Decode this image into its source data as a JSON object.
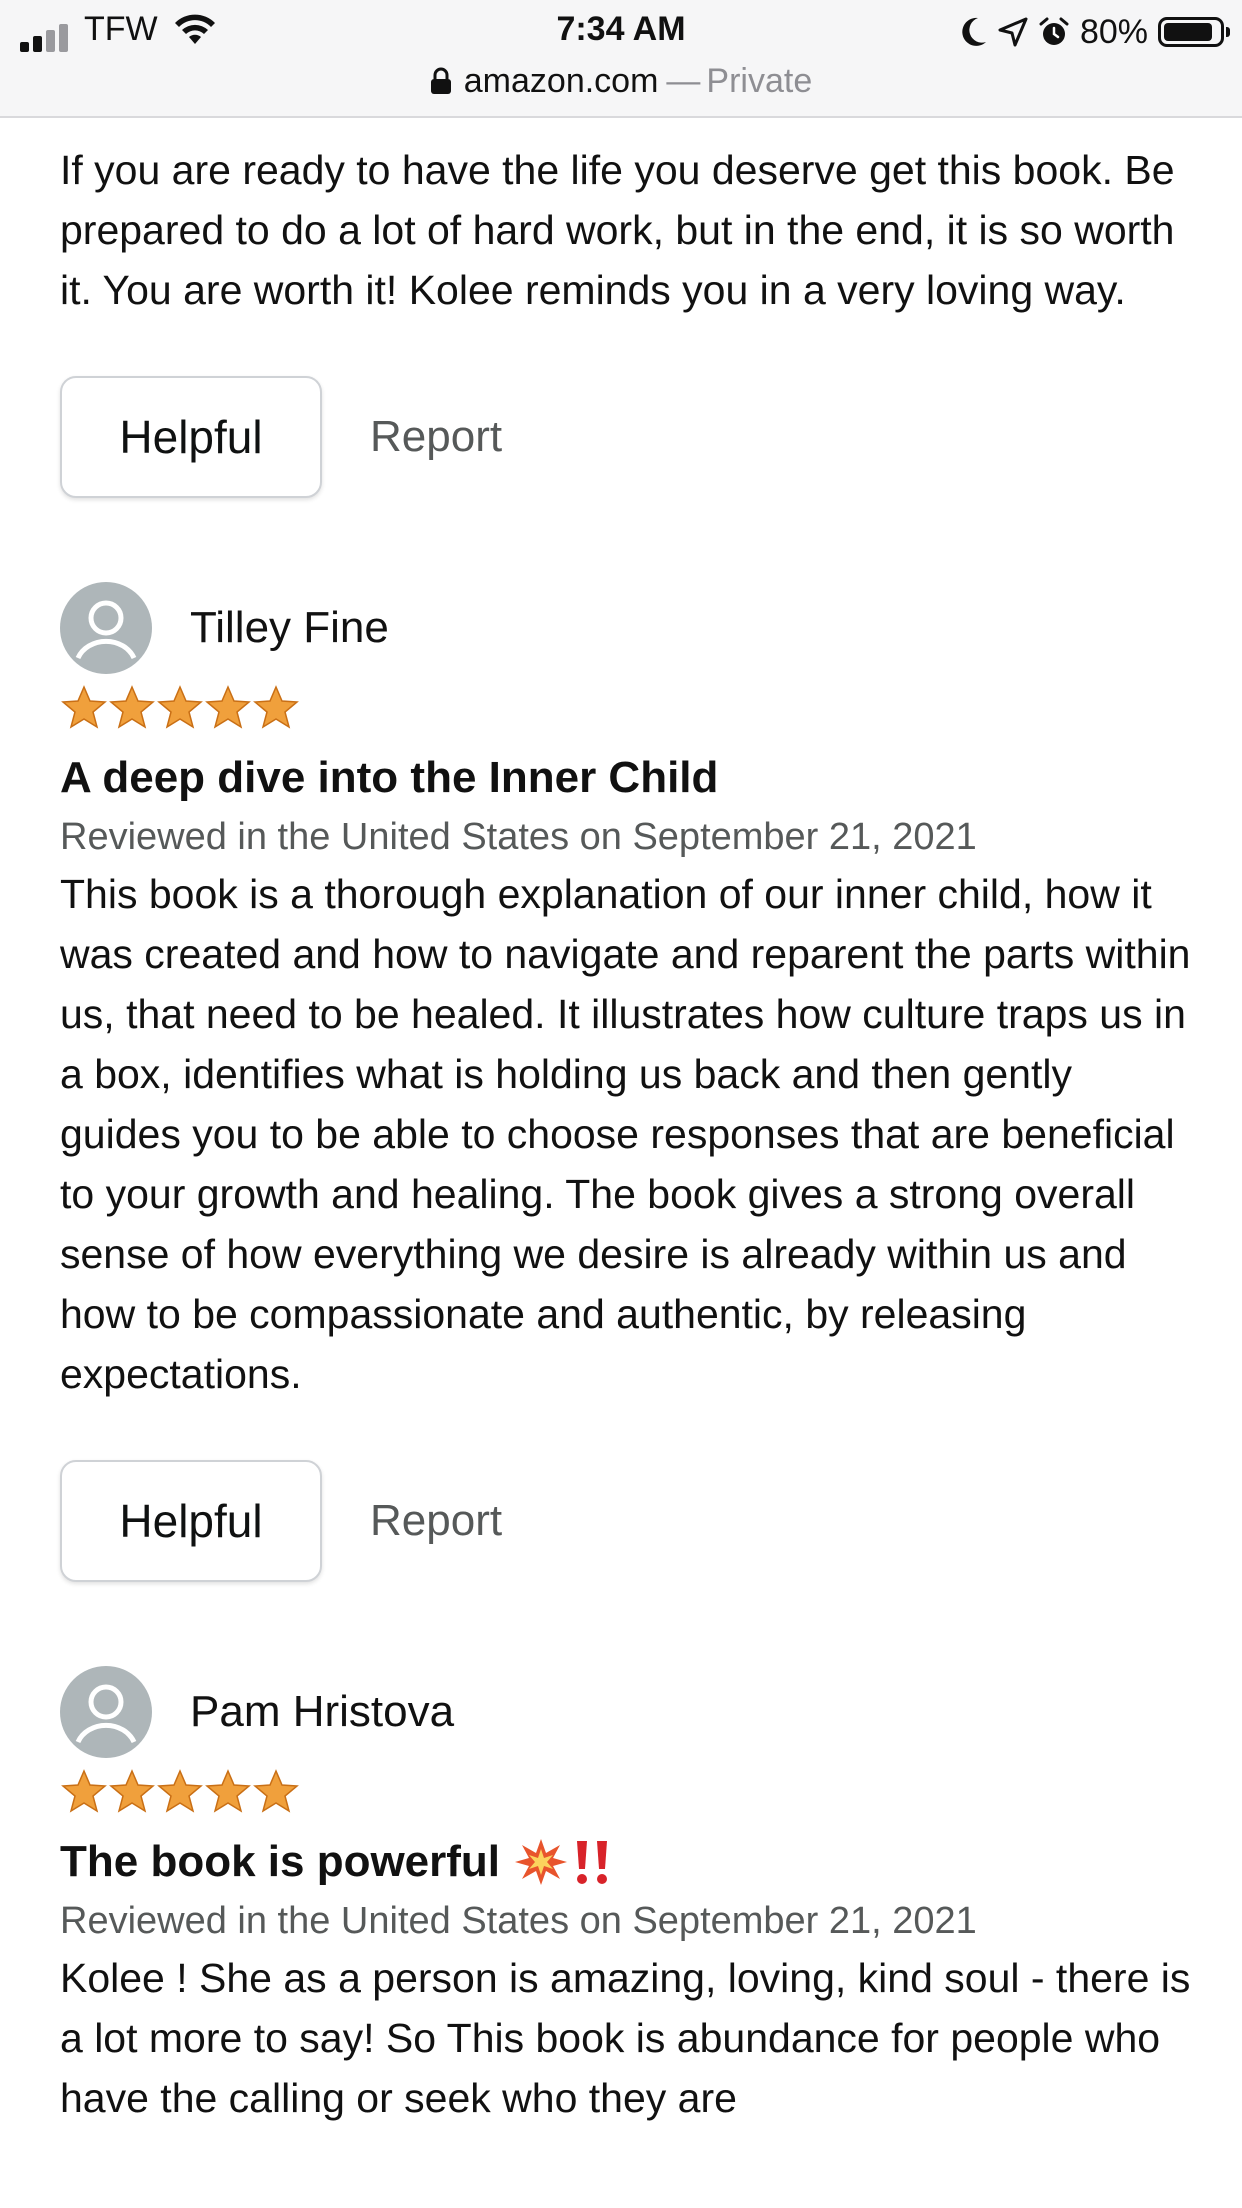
{
  "status_bar": {
    "carrier": "TFW",
    "time": "7:34 AM",
    "battery_percent": "80%",
    "battery_level": 0.8
  },
  "url_bar": {
    "domain": "amazon.com",
    "separator": "—",
    "mode": "Private"
  },
  "colors": {
    "star": "#f0a03c",
    "meta_text": "#565959",
    "avatar_bg": "#aeb6b9"
  },
  "previous_review": {
    "body": "If you are ready to have the life you deserve get this book. Be prepared to do a lot of hard work, but in the end, it is so worth it. You are worth it! Kolee reminds you in a very loving way.",
    "helpful_label": "Helpful",
    "report_label": "Report"
  },
  "reviews": [
    {
      "reviewer": "Tilley Fine",
      "rating": 5,
      "title": "A deep dive into the Inner Child",
      "meta": "Reviewed in the United States on September 21, 2021",
      "body": "This book is a thorough explanation of our inner child, how it was created and how to navigate and reparent the parts within us, that need to be healed. It illustrates how culture traps us in a box, identifies what is holding us back and then gently guides you to be able to choose responses that are beneficial to your growth and healing. The book gives a strong overall sense of how everything we desire is already within us and how to be compassionate and authentic, by releasing expectations.",
      "helpful_label": "Helpful",
      "report_label": "Report"
    },
    {
      "reviewer": "Pam Hristova",
      "rating": 5,
      "title": "The book is powerful",
      "title_icons": [
        "collision-emoji",
        "double-exclamation-emoji"
      ],
      "meta": "Reviewed in the United States on September 21, 2021",
      "body": "Kolee ! She as a person is amazing, loving, kind soul - there is a lot more to say! So This book is abundance for people who have the calling or seek who they are"
    }
  ]
}
